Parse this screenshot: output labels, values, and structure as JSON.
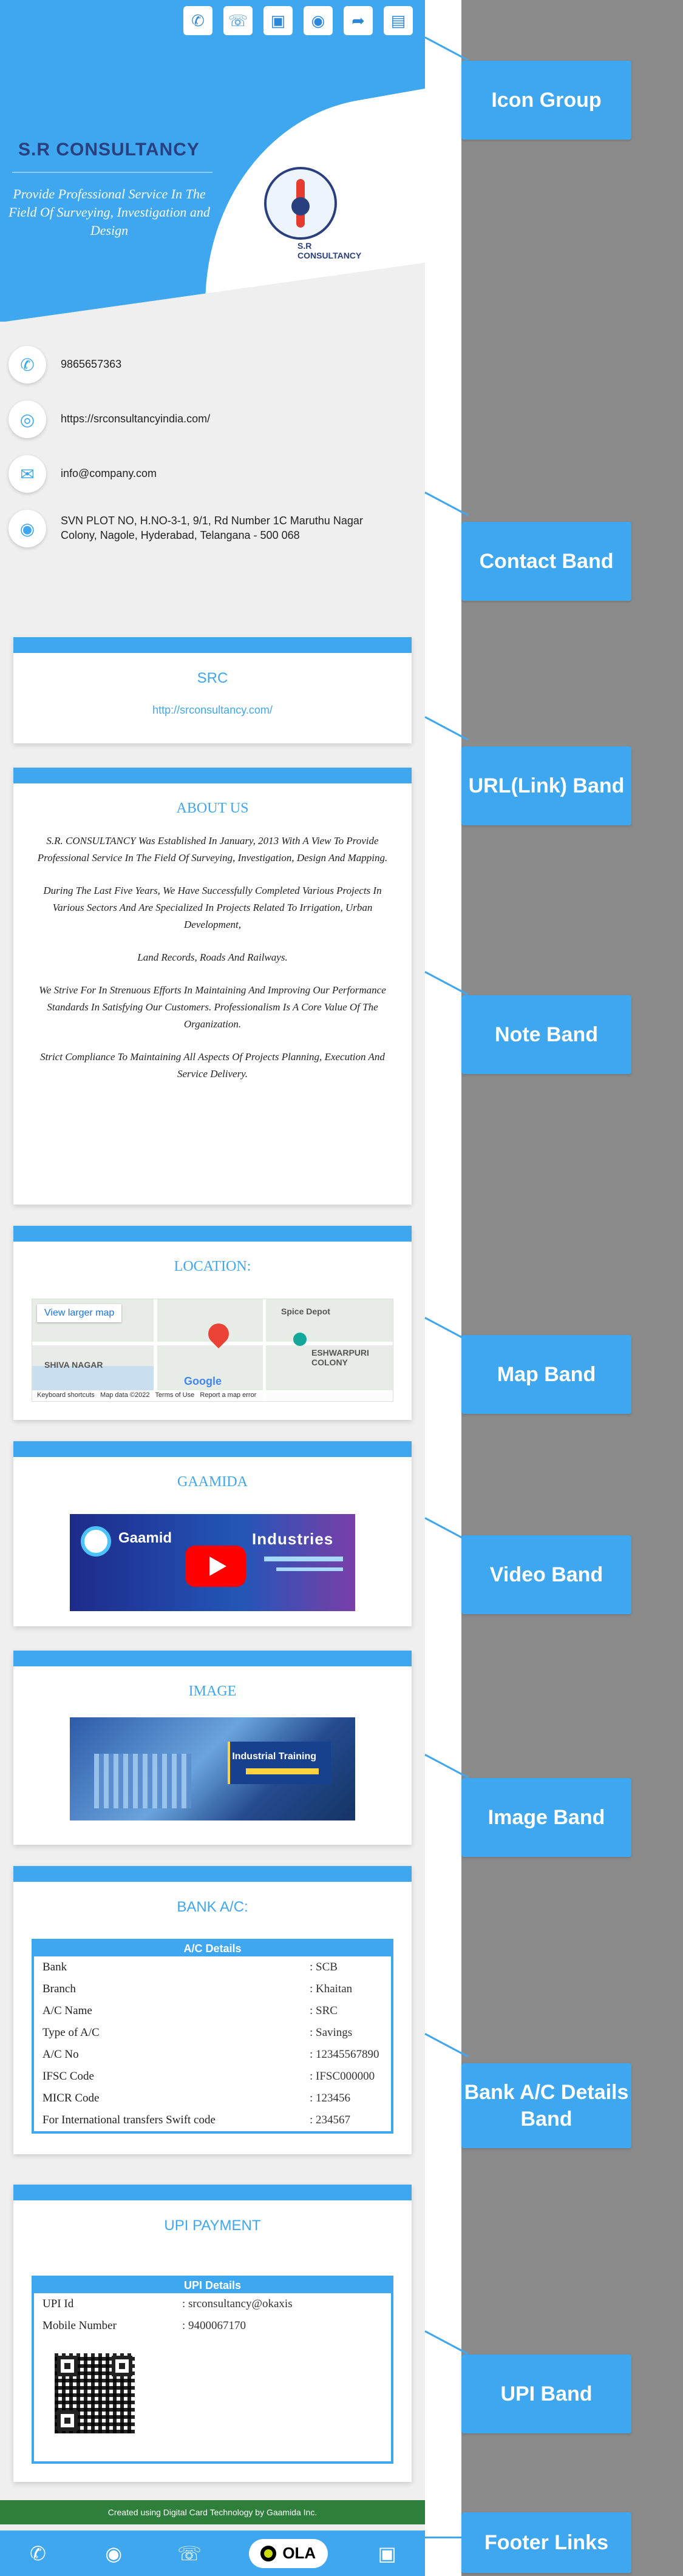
{
  "header": {
    "brand": "S.R CONSULTANCY",
    "tagline": "Provide Professional Service In The Field Of Surveying, Investigation and Design",
    "logo_text": "S.R CONSULTANCY",
    "icons": [
      "phone-icon",
      "whatsapp-icon",
      "sms-icon",
      "location-icon",
      "share-icon",
      "save-contact-icon"
    ]
  },
  "contact": {
    "phone": "9865657363",
    "website": "https://srconsultancyindia.com/",
    "email": "info@company.com",
    "address": "SVN PLOT NO, H.NO-3-1, 9/1, Rd Number 1C Maruthu Nagar Colony, Nagole, Hyderabad, Telangana - 500 068"
  },
  "url_band": {
    "title": "SRC",
    "url": "http://srconsultancy.com/"
  },
  "about": {
    "title": "ABOUT US",
    "paragraphs": [
      "S.R. CONSULTANCY Was Established In January, 2013 With A View To Provide Professional Service In The Field Of Surveying, Investigation, Design And Mapping.",
      "During The Last Five Years, We Have Successfully Completed Various Projects In Various Sectors And Are Specialized In Projects Related To Irrigation, Urban Development,",
      "Land Records, Roads And Railways.",
      "We Strive For In Strenuous Efforts In Maintaining And Improving Our Performance Standards In Satisfying Our Customers. Professionalism Is A Core Value Of The Organization.",
      "Strict Compliance To Maintaining All Aspects Of Projects Planning, Execution And Service Delivery."
    ]
  },
  "map_band": {
    "title": "LOCATION:",
    "view_larger": "View larger map",
    "labels": [
      "Spice Depot",
      "ESHWARPURI COLONY",
      "SHIVA NAGAR",
      "Keyboard shortcuts",
      "Map data ©2022",
      "Terms of Use",
      "Report a map error"
    ]
  },
  "video_band": {
    "title": "GAAMIDA",
    "video_text_left": "Gaamid",
    "video_text_right": "Industries"
  },
  "image_band": {
    "title": "IMAGE",
    "image_text": "Industrial Training"
  },
  "bank_band": {
    "title": "BANK A/C:",
    "table_title": "A/C Details",
    "rows": [
      {
        "k": "Bank",
        "v": ": SCB"
      },
      {
        "k": "Branch",
        "v": ": Khaitan"
      },
      {
        "k": "A/C Name",
        "v": ": SRC"
      },
      {
        "k": "Type of A/C",
        "v": ": Savings"
      },
      {
        "k": "A/C No",
        "v": ": 12345567890"
      },
      {
        "k": "IFSC Code",
        "v": ": IFSC000000"
      },
      {
        "k": "MICR Code",
        "v": ": 123456"
      },
      {
        "k": "For International transfers Swift code",
        "v": ": 234567"
      }
    ]
  },
  "upi_band": {
    "title": "UPI PAYMENT",
    "table_title": "UPI Details",
    "rows": [
      {
        "k": "UPI Id",
        "v": ": srconsultancy@okaxis"
      },
      {
        "k": "Mobile Number",
        "v": ": 9400067170"
      }
    ]
  },
  "credit": "Created using Digital Card Technology by Gaamida Inc.",
  "footer": {
    "ola_label": "OLA",
    "icons": [
      "phone-icon",
      "location-icon",
      "whatsapp-icon",
      "ola-icon",
      "sms-icon"
    ]
  },
  "annotations": {
    "icon_group": "Icon Group",
    "contact_band": "Contact Band",
    "url_band": "URL(Link) Band",
    "note_band": "Note Band",
    "map_band": "Map Band",
    "video_band": "Video Band",
    "image_band": "Image Band",
    "bank_band": "Bank A/C Details Band",
    "upi_band": "UPI Band",
    "footer_links": "Footer Links"
  },
  "colors": {
    "accent": "#3ea7ef",
    "brand_dark": "#2a3f7e",
    "credit_green": "#2f7f3c"
  }
}
